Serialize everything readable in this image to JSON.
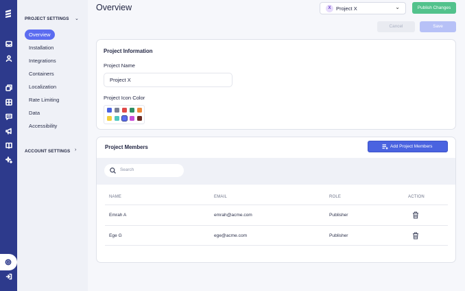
{
  "page": {
    "title": "Overview"
  },
  "rail": {
    "icons": [
      "logo-icon",
      "inbox-icon",
      "user-icon",
      "layers-icon",
      "grid-icon",
      "chat-icon",
      "megaphone-icon",
      "book-icon",
      "sparkle-icon",
      "settings-icon",
      "logout-icon"
    ],
    "active": "settings-icon"
  },
  "sidebar": {
    "project_settings": "PROJECT SETTINGS",
    "items": [
      {
        "label": "Overview"
      },
      {
        "label": "Installation"
      },
      {
        "label": "Integrations"
      },
      {
        "label": "Containers"
      },
      {
        "label": "Localization"
      },
      {
        "label": "Rate Limiting"
      },
      {
        "label": "Data"
      },
      {
        "label": "Accessibility"
      }
    ],
    "active_item": "Overview",
    "account_settings": "ACCOUNT SETTINGS"
  },
  "header": {
    "project_badge": "X",
    "project_name": "Project X",
    "publish_label": "Publish Changes",
    "cancel_label": "Cancel",
    "save_label": "Save"
  },
  "project_info": {
    "title": "Project Information",
    "name_label": "Project Name",
    "name_value": "Project X",
    "color_label": "Project Icon Color",
    "colors": [
      "#4a63e0",
      "#7a8195",
      "#e04848",
      "#2f8f63",
      "#ee8a3a",
      "#f2cf3b",
      "#4ec7c0",
      "#5b6cf0",
      "#c94bd8",
      "#6b2a22"
    ],
    "selected_color": "#5b6cf0"
  },
  "members": {
    "title": "Project Members",
    "add_label": "Add Project Members",
    "search_placeholder": "Search",
    "columns": [
      "NAME",
      "EMAIL",
      "ROLE",
      "ACTION"
    ],
    "rows": [
      {
        "name": "Emrah A",
        "email": "emrah@acme.com",
        "role": "Publisher",
        "action": "delete-icon"
      },
      {
        "name": "Ege G",
        "email": "ege@acme.com",
        "role": "Publisher",
        "action": "delete-icon"
      }
    ]
  },
  "theme": {
    "rail": "#2d3a8c",
    "accent": "#5b6cf0",
    "publish": "#52c28c",
    "add_button": "#4a63e0"
  }
}
